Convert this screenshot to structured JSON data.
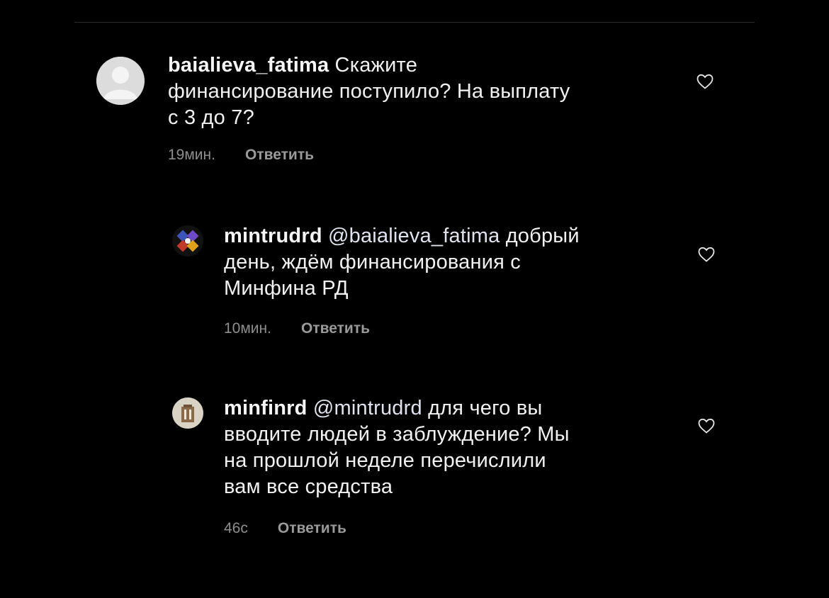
{
  "comments": [
    {
      "username": "baialieva_fatima",
      "mention": "",
      "text_lines": [
        "Скажите",
        "финансирование поступило? На выплату",
        "с 3 до 7?"
      ],
      "time": "19мин.",
      "reply_label": "Ответить",
      "avatar_icon": "default-avatar-icon"
    },
    {
      "username": "mintrudrd",
      "mention": "@baialieva_fatima",
      "text_lines": [
        "добрый",
        "день, ждём финансирования с",
        "Минфина РД"
      ],
      "time": "10мин.",
      "reply_label": "Ответить",
      "avatar_icon": "ministry-logo-icon"
    },
    {
      "username": "minfinrd",
      "mention": "@mintrudrd",
      "text_lines": [
        "для чего вы",
        "вводите людей в заблуждение? Мы",
        "на прошлой неделе перечислили",
        "вам все средства"
      ],
      "time": "46с",
      "reply_label": "Ответить",
      "avatar_icon": "building-avatar-icon"
    }
  ],
  "icons": {
    "like": "heart-outline-icon"
  },
  "colors": {
    "background": "#000000",
    "text": "#f1f1f1",
    "meta": "#8e8e8e"
  }
}
